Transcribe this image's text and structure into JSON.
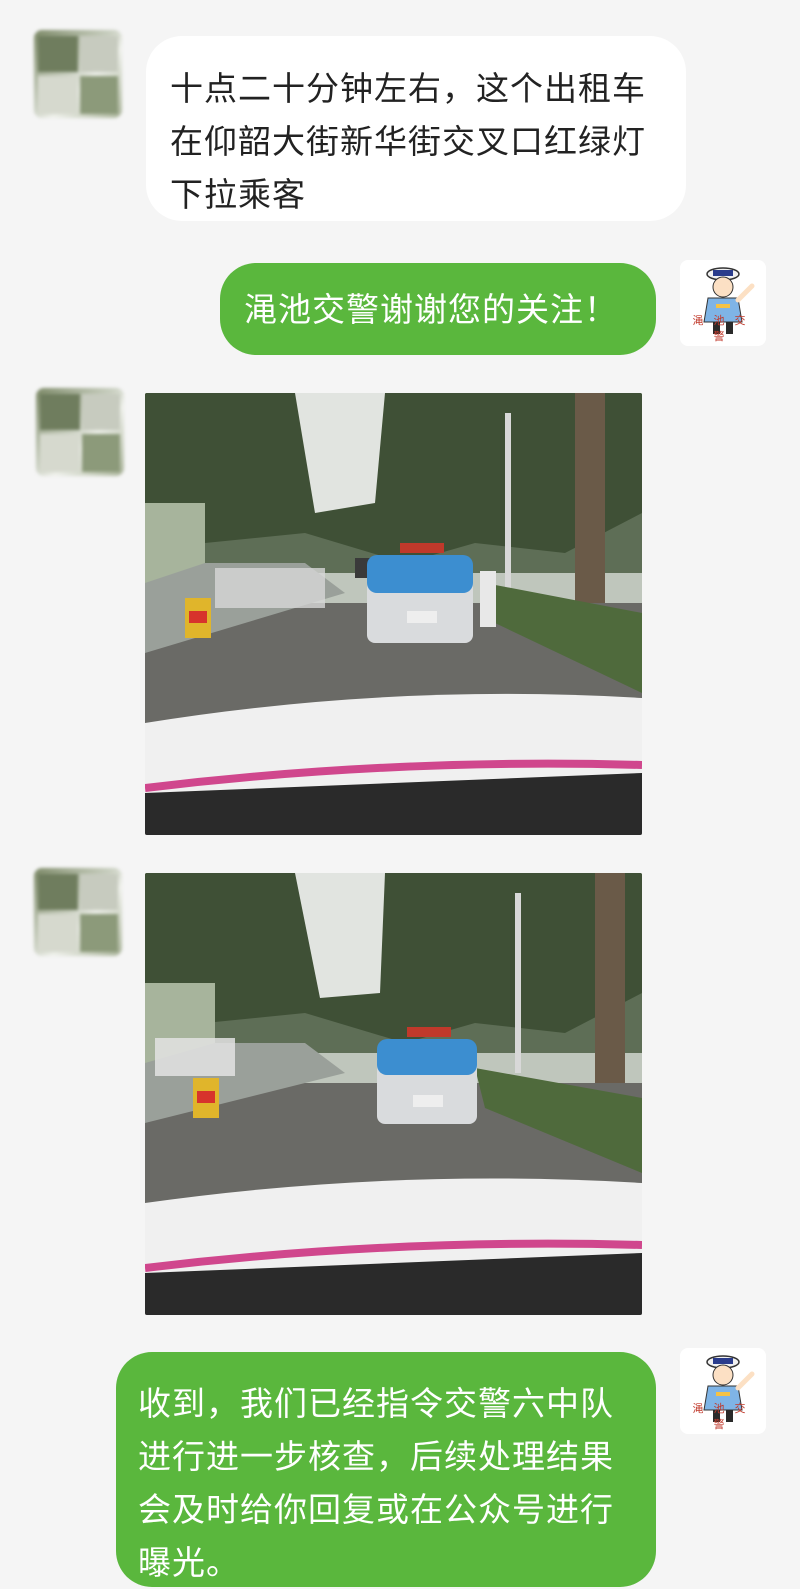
{
  "messages": [
    {
      "sender": "user",
      "avatar_icon": "blurred-avatar",
      "lines": [
        "十点二十分钟左右，这个出租车",
        "在仰韶大街新华街交叉口红绿灯",
        "下拉乘客"
      ]
    },
    {
      "sender": "police",
      "avatar_icon": "traffic-police-avatar",
      "avatar_text": "渑池交警",
      "lines": [
        "渑池交警谢谢您的关注！"
      ]
    },
    {
      "sender": "user",
      "avatar_icon": "blurred-avatar",
      "type": "photo",
      "photo_icon": "taxi-street-photo"
    },
    {
      "sender": "user",
      "avatar_icon": "blurred-avatar",
      "type": "photo",
      "photo_icon": "taxi-street-photo"
    },
    {
      "sender": "police",
      "avatar_icon": "traffic-police-avatar",
      "avatar_text": "渑池交警",
      "lines": [
        "收到，我们已经指令交警六中队",
        "进行进一步核查，后续处理结果",
        "会及时给你回复或在公众号进行",
        "曝光。"
      ]
    }
  ],
  "colors": {
    "outgoing_bubble": "#5ab73d",
    "incoming_bubble": "#ffffff",
    "background": "#f5f5f5"
  }
}
